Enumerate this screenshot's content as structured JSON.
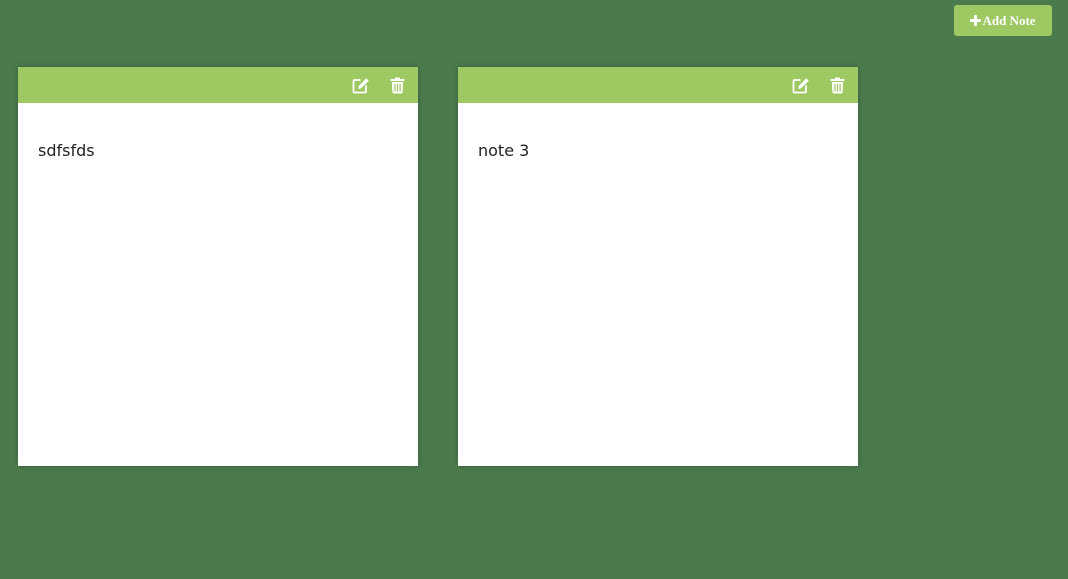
{
  "toolbar": {
    "add_note_label": "Add Note"
  },
  "notes": [
    {
      "text": "sdfsfds"
    },
    {
      "text": "note 3"
    }
  ],
  "colors": {
    "background": "#4b7b4d",
    "accent": "#9dc862",
    "note_body": "#ffffff"
  },
  "icons": {
    "add": "plus-icon",
    "edit": "edit-icon",
    "delete": "trash-icon"
  }
}
